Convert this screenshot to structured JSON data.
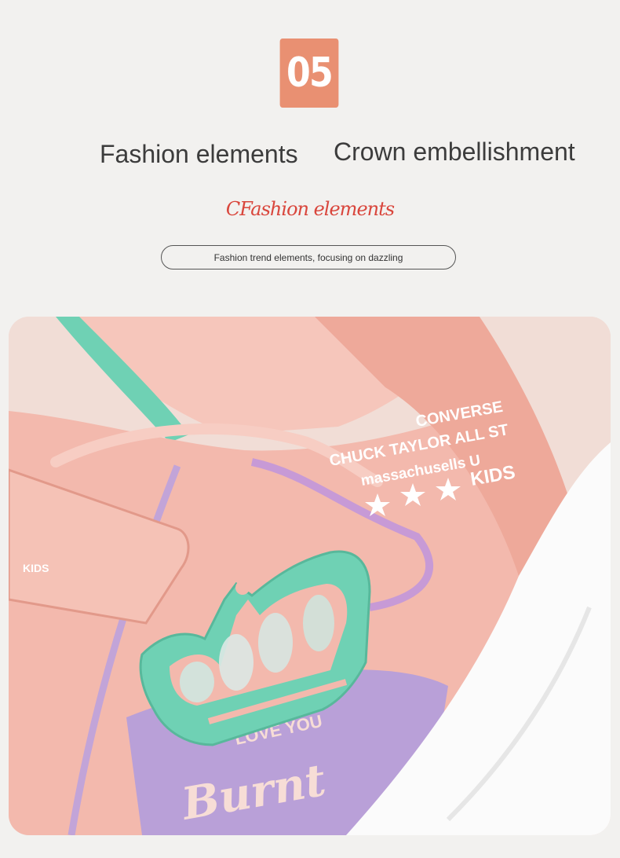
{
  "section": {
    "number": "05",
    "heading_left": "Fashion elements",
    "heading_right": "Crown embellishment",
    "script_title": "CFashion elements",
    "pill_text": "Fashion trend elements, focusing on dazzling"
  },
  "photo": {
    "printed_text": {
      "line1": "CONVERSE",
      "line2": "CHUCK TAYLOR ALL ST",
      "line3": "massachusells U",
      "kids_right": "KIDS",
      "kids_left": "KIDS",
      "love_you": "LOVE YOU",
      "burnt": "Burnt"
    },
    "colors": {
      "leather": "#f3b9ad",
      "leather_dark": "#e7a596",
      "mint": "#6fd1b4",
      "sole": "#fbfbfb",
      "lavender": "#b9a0d8",
      "accent": "#e99072"
    }
  }
}
